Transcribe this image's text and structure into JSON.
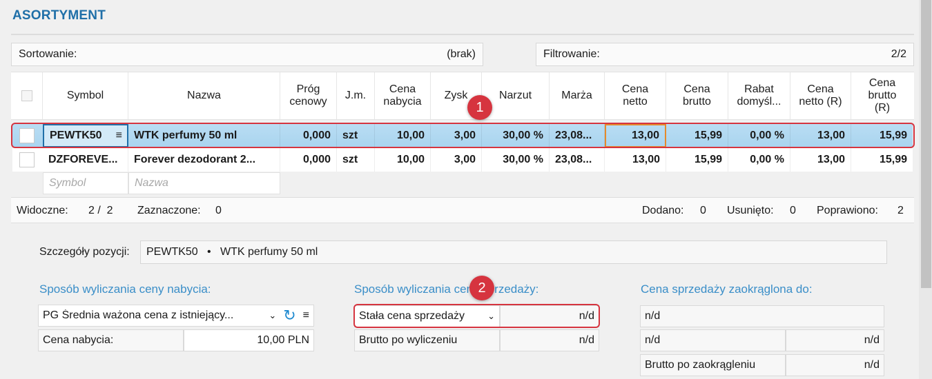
{
  "page": {
    "title": "ASORTYMENT"
  },
  "sort": {
    "label": "Sortowanie:",
    "value": "(brak)"
  },
  "filter": {
    "label": "Filtrowanie:",
    "value": "2/2"
  },
  "columns": {
    "symbol": "Symbol",
    "nazwa": "Nazwa",
    "prog": "Próg\ncenowy",
    "jm": "J.m.",
    "cena_nabycia": "Cena\nnabycia",
    "zysk": "Zysk",
    "narzut": "Narzut",
    "marza": "Marża",
    "cena_netto": "Cena\nnetto",
    "cena_brutto": "Cena\nbrutto",
    "rabat": "Rabat\ndomyśl...",
    "cena_netto_r": "Cena\nnetto (R)",
    "cena_brutto_r": "Cena\nbrutto\n(R)"
  },
  "rows": [
    {
      "symbol": "PEWTK50",
      "nazwa": "WTK perfumy 50 ml",
      "prog": "0,000",
      "jm": "szt",
      "cena_nabycia": "10,00",
      "zysk": "3,00",
      "narzut": "30,00 %",
      "marza": "23,08...",
      "cena_netto": "13,00",
      "cena_brutto": "15,99",
      "rabat": "0,00 %",
      "cena_netto_r": "13,00",
      "cena_brutto_r": "15,99"
    },
    {
      "symbol": "DZFOREVE...",
      "nazwa": "Forever dezodorant 2...",
      "prog": "0,000",
      "jm": "szt",
      "cena_nabycia": "10,00",
      "zysk": "3,00",
      "narzut": "30,00 %",
      "marza": "23,08...",
      "cena_netto": "13,00",
      "cena_brutto": "15,99",
      "rabat": "0,00 %",
      "cena_netto_r": "13,00",
      "cena_brutto_r": "15,99"
    }
  ],
  "filter_row": {
    "symbol_placeholder": "Symbol",
    "nazwa_placeholder": "Nazwa"
  },
  "badges": {
    "one": "1",
    "two": "2"
  },
  "status": {
    "widoczne_label": "Widoczne:",
    "widoczne_value": "2 /  2",
    "zaznaczone_label": "Zaznaczone:",
    "zaznaczone_value": "0",
    "dodano_label": "Dodano:",
    "dodano_value": "0",
    "usunieto_label": "Usunięto:",
    "usunieto_value": "0",
    "poprawiono_label": "Poprawiono:",
    "poprawiono_value": "2"
  },
  "details": {
    "label": "Szczegóły pozycji:",
    "value": "PEWTK50   •   WTK perfumy 50 ml"
  },
  "purchase": {
    "heading": "Sposób wyliczania ceny nabycia:",
    "method": "PG  Średnia ważona cena z istniejący...",
    "price_label": "Cena nabycia:",
    "price_value": "10,00 PLN"
  },
  "sale": {
    "heading": "Sposób wyliczania ceny sprzedaży:",
    "method": "Stała cena sprzedaży",
    "method_value": "n/d",
    "brutto_label": "Brutto po wyliczeniu",
    "brutto_value": "n/d"
  },
  "rounding": {
    "heading": "Cena sprzedaży zaokrąglona do:",
    "value1": "n/d",
    "value2_left": "n/d",
    "value2_right": "n/d",
    "brutto_label": "Brutto po zaokrągleniu",
    "brutto_value": "n/d"
  },
  "icons": {
    "menu": "≡",
    "chevron": "⌄",
    "refresh": "↻"
  },
  "colors": {
    "accent": "#1f6fa8",
    "selection": "#b9ddf3",
    "highlight": "#d6343f"
  }
}
